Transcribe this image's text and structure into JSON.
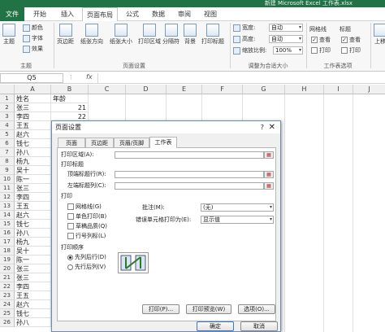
{
  "window": {
    "title": "新建 Microsoft Excel 工作表.xlsx"
  },
  "tabs": [
    {
      "label": "文件"
    },
    {
      "label": "开始"
    },
    {
      "label": "插入"
    },
    {
      "label": "页面布局"
    },
    {
      "label": "公式"
    },
    {
      "label": "数据"
    },
    {
      "label": "审阅"
    },
    {
      "label": "视图"
    }
  ],
  "ribbon": {
    "theme": {
      "main": "主题",
      "colors": "颜色",
      "fonts": "字体",
      "effects": "效果",
      "group": "主题"
    },
    "setup": {
      "margins": "页边距",
      "orientation": "纸张方向",
      "size": "纸张大小",
      "print_area": "打印区域",
      "breaks": "分隔符",
      "background": "背景",
      "print_titles": "打印标题",
      "group": "页面设置"
    },
    "scale": {
      "width_label": "宽度:",
      "width_value": "自动",
      "height_label": "高度:",
      "height_value": "自动",
      "scale_label": "缩放比例:",
      "scale_value": "100%",
      "group": "调整为合适大小"
    },
    "options": {
      "gridlines": "网格线",
      "headings": "标题",
      "view1": "查看",
      "view2": "查看",
      "print1": "打印",
      "print2": "打印",
      "group": "工作表选项"
    },
    "arrange": {
      "bring_forward": "上移"
    }
  },
  "formula_bar": {
    "name_box": "Q5",
    "fx": "fx"
  },
  "grid": {
    "columns": [
      "A",
      "B",
      "C",
      "D",
      "E",
      "F",
      "G",
      "H",
      "I",
      "J"
    ],
    "rows": [
      {
        "n": "1",
        "a": "姓名",
        "b": "年龄"
      },
      {
        "n": "2",
        "a": "张三",
        "b": "21"
      },
      {
        "n": "3",
        "a": "李四",
        "b": "22"
      },
      {
        "n": "4",
        "a": "王五",
        "b": ""
      },
      {
        "n": "5",
        "a": "赵六",
        "b": ""
      },
      {
        "n": "6",
        "a": "钱七",
        "b": ""
      },
      {
        "n": "7",
        "a": "孙八",
        "b": ""
      },
      {
        "n": "8",
        "a": "杨九",
        "b": ""
      },
      {
        "n": "9",
        "a": "吴十",
        "b": ""
      },
      {
        "n": "10",
        "a": "陈一",
        "b": ""
      },
      {
        "n": "11",
        "a": "张三",
        "b": ""
      },
      {
        "n": "12",
        "a": "李四",
        "b": ""
      },
      {
        "n": "13",
        "a": "王五",
        "b": ""
      },
      {
        "n": "14",
        "a": "赵六",
        "b": ""
      },
      {
        "n": "15",
        "a": "钱七",
        "b": ""
      },
      {
        "n": "16",
        "a": "孙八",
        "b": ""
      },
      {
        "n": "17",
        "a": "杨九",
        "b": ""
      },
      {
        "n": "18",
        "a": "吴十",
        "b": ""
      },
      {
        "n": "19",
        "a": "陈一",
        "b": ""
      },
      {
        "n": "20",
        "a": "张三",
        "b": ""
      },
      {
        "n": "21",
        "a": "张三",
        "b": ""
      },
      {
        "n": "22",
        "a": "李四",
        "b": ""
      },
      {
        "n": "23",
        "a": "王五",
        "b": ""
      },
      {
        "n": "24",
        "a": "赵六",
        "b": ""
      },
      {
        "n": "25",
        "a": "钱七",
        "b": ""
      },
      {
        "n": "26",
        "a": "孙八",
        "b": ""
      }
    ]
  },
  "dialog": {
    "title": "页面设置",
    "help": "?",
    "close": "✕",
    "tabs": [
      {
        "label": "页面"
      },
      {
        "label": "页边距"
      },
      {
        "label": "页眉/页脚"
      },
      {
        "label": "工作表"
      }
    ],
    "print_area_label": "打印区域(A):",
    "print_titles_label": "打印标题",
    "rows_repeat_label": "顶端标题行(R):",
    "cols_repeat_label": "左端标题列(C):",
    "print_section": "打印",
    "gridlines": "网格线(G)",
    "mono": "单色打印(B)",
    "draft": "草稿品质(Q)",
    "row_col_headings": "行号列标(L)",
    "comments_label": "批注(M):",
    "comments_value": "(无)",
    "errors_label": "错误单元格打印为(E):",
    "errors_value": "显示值",
    "order_label": "打印顺序",
    "down_then_over": "先列后行(D)",
    "over_then_down": "先行后列(V)",
    "print_btn": "打印(P)...",
    "preview_btn": "打印预览(W)",
    "options_btn": "选项(O)...",
    "ok_btn": "确定",
    "cancel_btn": "取消"
  }
}
